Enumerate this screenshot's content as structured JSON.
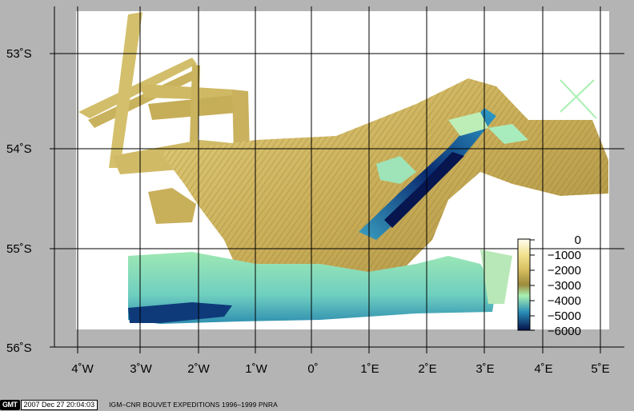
{
  "map": {
    "latitude_labels": [
      "53˚S",
      "54˚S",
      "55˚S",
      "56˚S"
    ],
    "longitude_labels": [
      "4˚W",
      "3˚W",
      "2˚W",
      "1˚W",
      "0˚",
      "1˚E",
      "2˚E",
      "3˚E",
      "4˚E",
      "5˚E"
    ],
    "colors": {
      "background": "#b4b4b4",
      "plot_area": "#ffffff",
      "grid": "#000000"
    }
  },
  "colorbar": {
    "ticks": [
      "0",
      "−1000",
      "−2000",
      "−3000",
      "−4000",
      "−5000",
      "−6000"
    ],
    "stops": [
      {
        "value": 0,
        "color": "#fffdf0"
      },
      {
        "value": -1000,
        "color": "#f2e290"
      },
      {
        "value": -2000,
        "color": "#d9c062"
      },
      {
        "value": -3000,
        "color": "#9c8a3c"
      },
      {
        "value": -4000,
        "color": "#a8f0b0"
      },
      {
        "value": -5000,
        "color": "#2a8fb8"
      },
      {
        "value": -6000,
        "color": "#05104a"
      }
    ]
  },
  "footer": {
    "logo": "GMT",
    "timestamp": "2007 Dec 27 20:04:03",
    "caption": "IGM–CNR BOUVET EXPEDITIONS 1996–1999 PNRA"
  }
}
